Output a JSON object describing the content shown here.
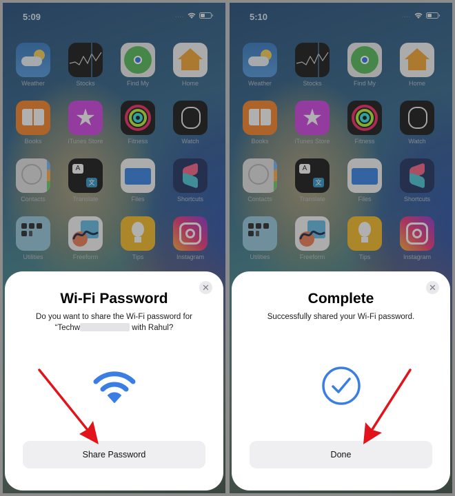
{
  "colors": {
    "accent_blue": "#3a7ee4",
    "annotation_red": "#e2141b",
    "sheet_background": "#ffffff",
    "button_background": "#efeff2"
  },
  "apps": [
    {
      "name": "Weather",
      "icon": "weather-icon"
    },
    {
      "name": "Stocks",
      "icon": "stocks-icon"
    },
    {
      "name": "Find My",
      "icon": "find-my-icon"
    },
    {
      "name": "Home",
      "icon": "home-icon"
    },
    {
      "name": "Books",
      "icon": "books-icon"
    },
    {
      "name": "iTunes Store",
      "icon": "itunes-store-icon"
    },
    {
      "name": "Fitness",
      "icon": "fitness-icon"
    },
    {
      "name": "Watch",
      "icon": "watch-icon"
    },
    {
      "name": "Contacts",
      "icon": "contacts-icon"
    },
    {
      "name": "Translate",
      "icon": "translate-icon"
    },
    {
      "name": "Files",
      "icon": "files-icon"
    },
    {
      "name": "Shortcuts",
      "icon": "shortcuts-icon"
    },
    {
      "name": "Utilities",
      "icon": "utilities-folder-icon"
    },
    {
      "name": "Freeform",
      "icon": "freeform-icon"
    },
    {
      "name": "Tips",
      "icon": "tips-icon"
    },
    {
      "name": "Instagram",
      "icon": "instagram-icon"
    }
  ],
  "screens": [
    {
      "status": {
        "time": "5:09",
        "signal": "....",
        "wifi": "wifi-icon",
        "battery": "battery-icon"
      },
      "sheet": {
        "title": "Wi-Fi Password",
        "subtitle_line1": "Do you want to share the Wi-Fi password for",
        "subtitle_prefix": "“Techw",
        "subtitle_suffix": " with Rahul?",
        "glyph": "wifi-icon",
        "button_label": "Share Password",
        "close_icon": "close-icon"
      },
      "annotation": "red-arrow-pointing-to-share-password"
    },
    {
      "status": {
        "time": "5:10",
        "signal": "....",
        "wifi": "wifi-icon",
        "battery": "battery-icon"
      },
      "sheet": {
        "title": "Complete",
        "subtitle_line1": "Successfully shared your Wi-Fi password.",
        "glyph": "checkmark-circle-icon",
        "button_label": "Done",
        "close_icon": "close-icon"
      },
      "annotation": "red-arrow-pointing-to-done"
    }
  ]
}
